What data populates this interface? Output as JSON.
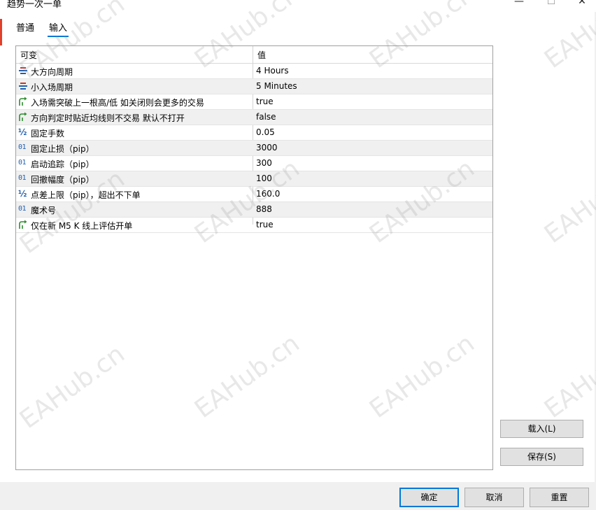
{
  "window": {
    "title": "趋势一次一单",
    "minimize_glyph": "—",
    "maximize_glyph": "☐",
    "close_glyph": "✕"
  },
  "tabs": [
    {
      "label": "普通",
      "active": false
    },
    {
      "label": "输入",
      "active": true
    }
  ],
  "grid": {
    "headers": {
      "variable": "可变",
      "value": "值"
    },
    "rows": [
      {
        "icon": "enum-icon",
        "name": "大方向周期",
        "value": "4 Hours"
      },
      {
        "icon": "enum-icon",
        "name": "小入场周期",
        "value": "5 Minutes"
      },
      {
        "icon": "bool-icon",
        "name": "入场需突破上一根高/低 如关闭则会更多的交易",
        "value": "true"
      },
      {
        "icon": "bool-icon",
        "name": "方向判定时贴近均线则不交易 默认不打开",
        "value": "false"
      },
      {
        "icon": "double-icon",
        "name": "固定手数",
        "value": "0.05"
      },
      {
        "icon": "int-icon",
        "name": "固定止损（pip）",
        "value": "3000"
      },
      {
        "icon": "int-icon",
        "name": "启动追踪（pip）",
        "value": "300"
      },
      {
        "icon": "int-icon",
        "name": "回撤幅度（pip）",
        "value": "100"
      },
      {
        "icon": "double-icon",
        "name": "点差上限（pip），超出不下单",
        "value": "160.0"
      },
      {
        "icon": "int-icon",
        "name": "魔术号",
        "value": "888"
      },
      {
        "icon": "bool-icon",
        "name": "仅在新 M5 K 线上评估开单",
        "value": "true"
      }
    ]
  },
  "side_buttons": {
    "load": "载入(L)",
    "save": "保存(S)"
  },
  "bottom_buttons": {
    "ok": "确定",
    "cancel": "取消",
    "reset": "重置"
  },
  "icon_glyphs": {
    "double": "½",
    "int": "01"
  },
  "watermark": "EAHub.cn",
  "colors": {
    "accent": "#0078d7",
    "icon_blue": "#1f5fb0",
    "enum_red": "#c0392b",
    "bool_green": "#2e8b2e"
  }
}
